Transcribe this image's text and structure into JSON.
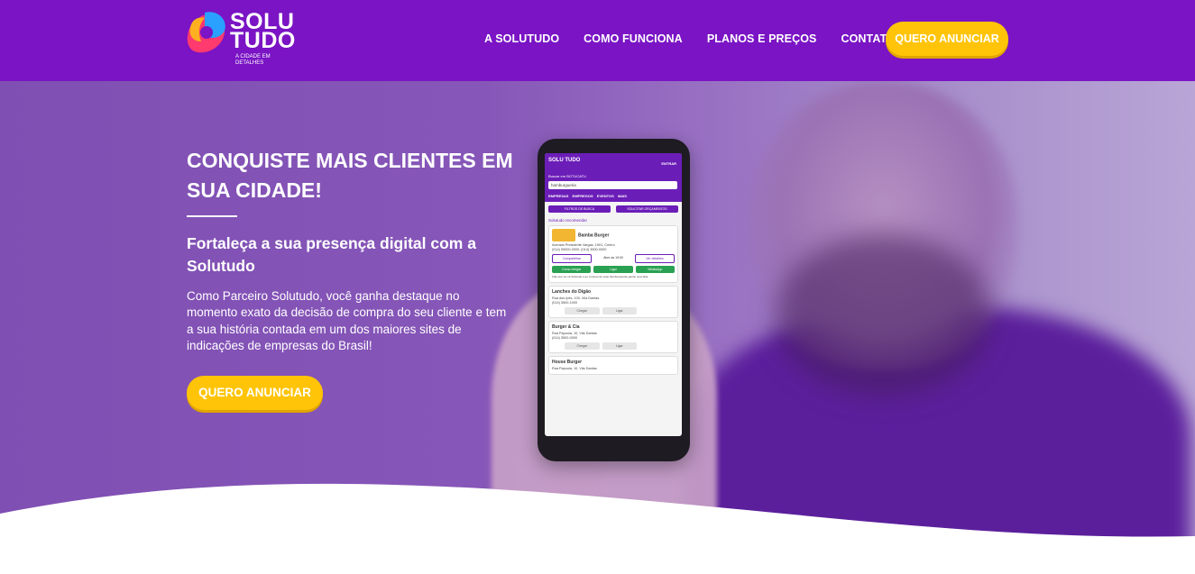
{
  "header": {
    "logo_line1": "SOLU",
    "logo_line2": "TUDO",
    "logo_tagline": "A CIDADE EM DETALHES",
    "nav": [
      "A SOLUTUDO",
      "COMO FUNCIONA",
      "PLANOS E PREÇOS",
      "CONTATO"
    ],
    "cta_label": "QUERO ANUNCIAR"
  },
  "hero": {
    "title": "CONQUISTE MAIS CLIENTES EM SUA CIDADE!",
    "subtitle": "Fortaleça a sua presença digital com a Solutudo",
    "body": "Como Parceiro Solutudo, você ganha destaque no momento exato da decisão de compra do seu cliente e tem a sua história contada em um dos maiores sites de indicações de empresas do Brasil!",
    "cta_label": "QUERO ANUNCIAR"
  },
  "phone": {
    "logo": "SOLU TUDO",
    "login": "ENTRAR",
    "city": "Buscar em BOTUCATU",
    "search_value": "hamburgueria",
    "tabs": "EMPRESAS EMPREGOS EVENTOS MAIS",
    "btn_filters": "FILTROS DE BUSCA",
    "btn_quote": "SOLICITAR ORÇAMENTOS",
    "recommend": "Solutudo recomenda!",
    "featured": {
      "name": "Bamba Burger",
      "address": "Avenida Presidente Vargas, 1501, Centro",
      "phone": "(014) 99000-0000, (014) 3500-0000",
      "share": "Compartilhar",
      "hours": "Abre as 19:00",
      "details": "Ver detalhes",
      "directions": "Como chegar",
      "call": "Ligar",
      "whatsapp": "WhatsApp",
      "note": "Fale que viu na Solutudo e ao comprar de suas hamburguerias ganhe uma fatia"
    },
    "listings": [
      {
        "name": "Lanches do Digão",
        "address": "Rua dos Ipês, 100, Vila Dantas",
        "phone": "(014) 3500-1000",
        "a1": "Chegar",
        "a2": "Ligar"
      },
      {
        "name": "Burger & Cia",
        "address": "Rua Papoula, 10, Vila Dantas",
        "phone": "(014) 3500-0000",
        "a1": "Chegar",
        "a2": "Ligar"
      },
      {
        "name": "House Burger",
        "address": "Rua Papoula, 10, Vila Dantas",
        "phone": "",
        "a1": "",
        "a2": ""
      }
    ]
  },
  "colors": {
    "purple": "#7a14c4",
    "yellow": "#ffc408"
  }
}
